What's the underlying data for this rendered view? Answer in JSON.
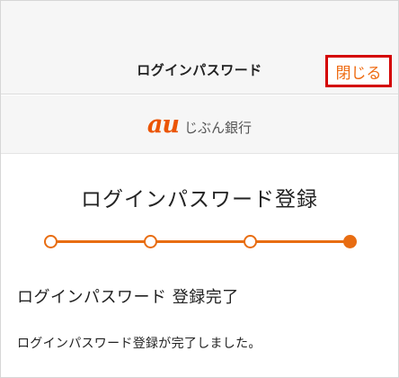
{
  "header": {
    "title": "ログインパスワード",
    "close_label": "閉じる",
    "close_border_color": "#d40000",
    "close_text_color": "#ee6a10"
  },
  "logo": {
    "mark": "au",
    "text": "じぶん銀行",
    "mark_color": "#eb5505"
  },
  "main": {
    "title": "ログインパスワード登録",
    "stepper": {
      "total_steps": 4,
      "current_step": 4,
      "accent_color": "#e86d12"
    },
    "section_title": "ログインパスワード 登録完了",
    "message": "ログインパスワード登録が完了しました。"
  }
}
